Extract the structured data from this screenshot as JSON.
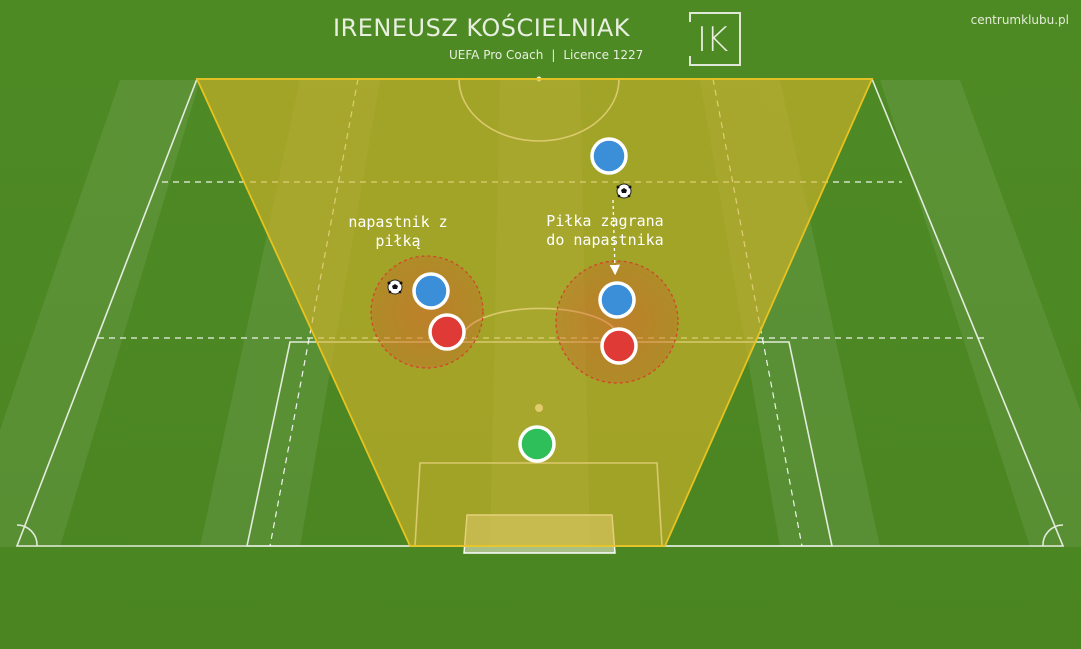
{
  "branding": {
    "name": "IRENEUSZ KOŚCIELNIAK",
    "role": "UEFA Pro Coach",
    "separator": "|",
    "licence": "Licence 1227",
    "logo_letters": "IK",
    "site_url": "centrumklubu.pl"
  },
  "annotations": {
    "striker_with_ball": "napastnik z\npiłką",
    "ball_passed_to_striker": "Piłka zagrana\ndo napastnika"
  },
  "colors": {
    "grass": "#4f8a26",
    "zone_fill": "#d6b52a",
    "zone_stroke": "#e8c21e",
    "team_blue": "#3a8fd8",
    "team_red": "#e03a36",
    "goalkeeper_green": "#2fbf5a",
    "pressure_ring": "#d2452c"
  },
  "players": [
    {
      "id": "blue-top",
      "team": "blue"
    },
    {
      "id": "blue-left",
      "team": "blue"
    },
    {
      "id": "red-left",
      "team": "red"
    },
    {
      "id": "blue-right",
      "team": "blue"
    },
    {
      "id": "red-right",
      "team": "red"
    },
    {
      "id": "goalkeeper",
      "team": "green"
    }
  ],
  "icons": [
    "soccer-ball-icon",
    "pass-arrow-icon"
  ]
}
